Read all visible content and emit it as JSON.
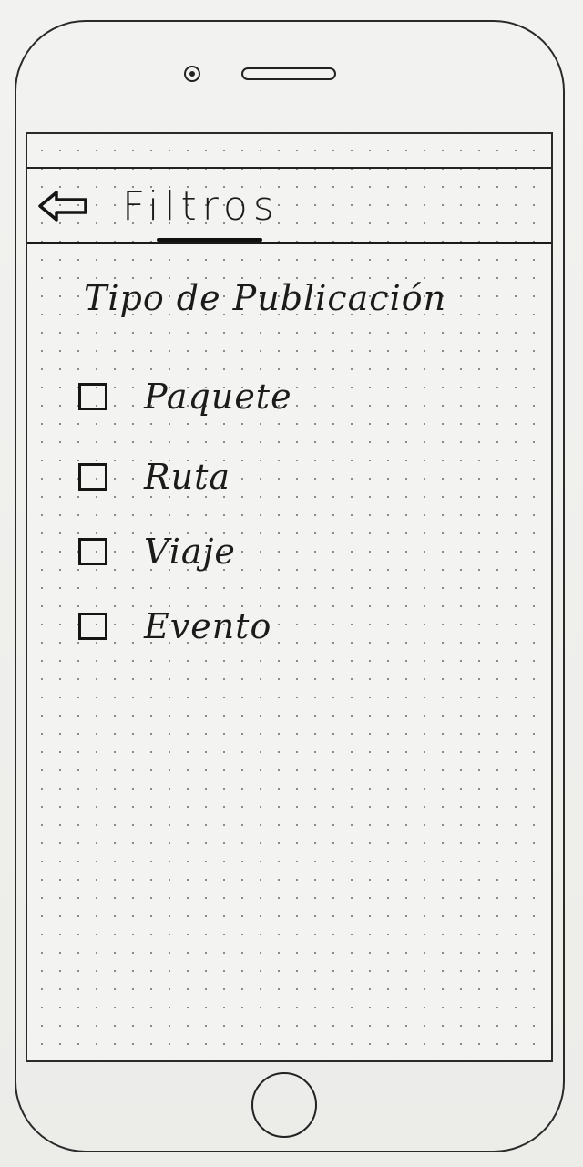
{
  "header": {
    "title": "Filtros",
    "back_icon": "arrow-left-icon"
  },
  "section": {
    "title": "Tipo de Publicación"
  },
  "options": [
    {
      "label": "Paquete",
      "checked": false
    },
    {
      "label": "Ruta",
      "checked": false
    },
    {
      "label": "Viaje",
      "checked": false
    },
    {
      "label": "Evento",
      "checked": false
    }
  ]
}
